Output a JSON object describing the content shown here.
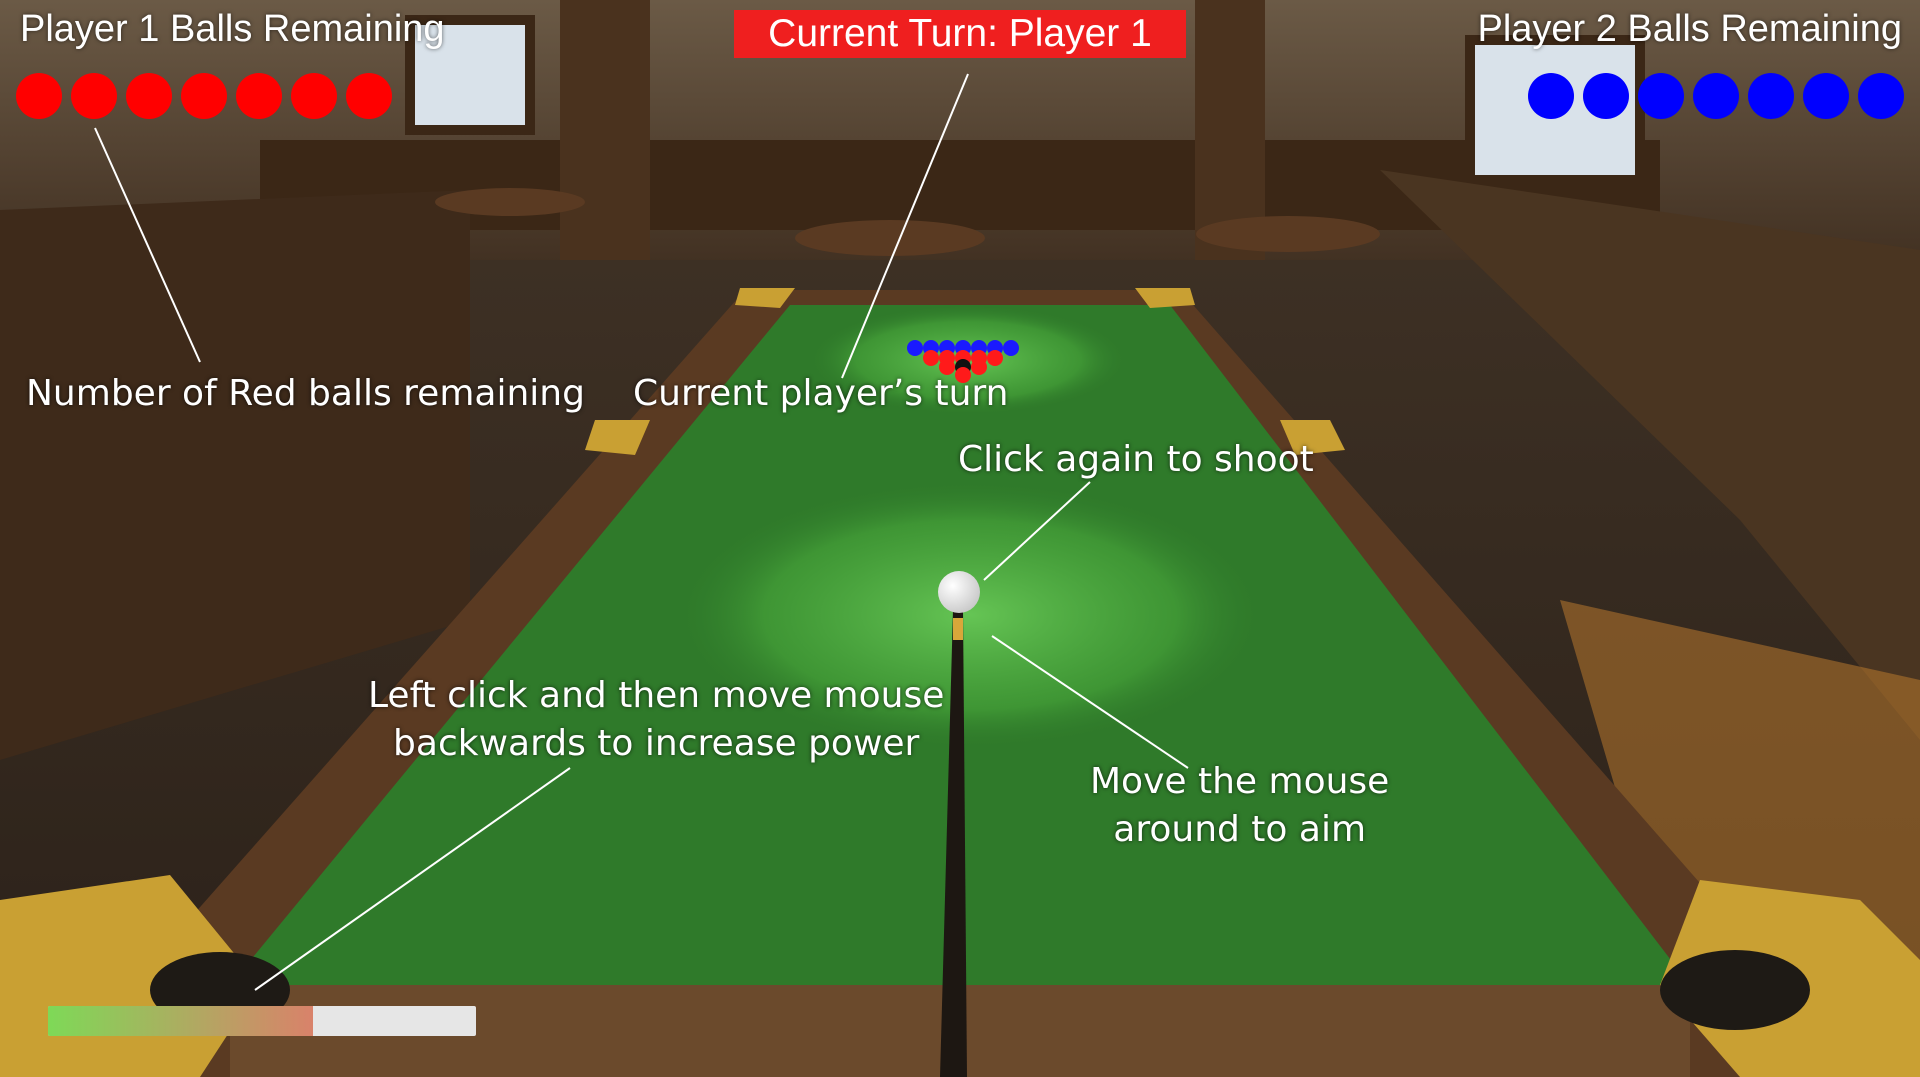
{
  "hud": {
    "player1": {
      "title": "Player 1 Balls Remaining",
      "balls_remaining": 7,
      "ball_color": "#ff0000"
    },
    "player2": {
      "title": "Player 2 Balls Remaining",
      "balls_remaining": 7,
      "ball_color": "#0000ff"
    },
    "turn_banner": {
      "text": "Current Turn: Player 1",
      "color": "#ef1f1f"
    },
    "power_bar": {
      "level": 0.62,
      "track_color": "#e6e6e6",
      "fill_start_color": "#7ed957",
      "fill_end_color": "#d9826a"
    }
  },
  "annotations": {
    "red_balls": "Number of Red balls remaining",
    "current_turn": "Current player’s turn",
    "click_shoot": "Click again to shoot",
    "power": [
      "Left click and then move mouse",
      "backwards to increase power"
    ],
    "aim": [
      "Move the mouse",
      "around to aim"
    ]
  },
  "scene": {
    "felt_color": "#2f7a2a",
    "rail_color": "#5a3a22",
    "pocket_color": "#c9a033",
    "floor_color": "#3a2a1c",
    "cue_ball_color": "#ffffff",
    "object_ball_colors": [
      "#ff1a1a",
      "#1a1aff"
    ]
  }
}
